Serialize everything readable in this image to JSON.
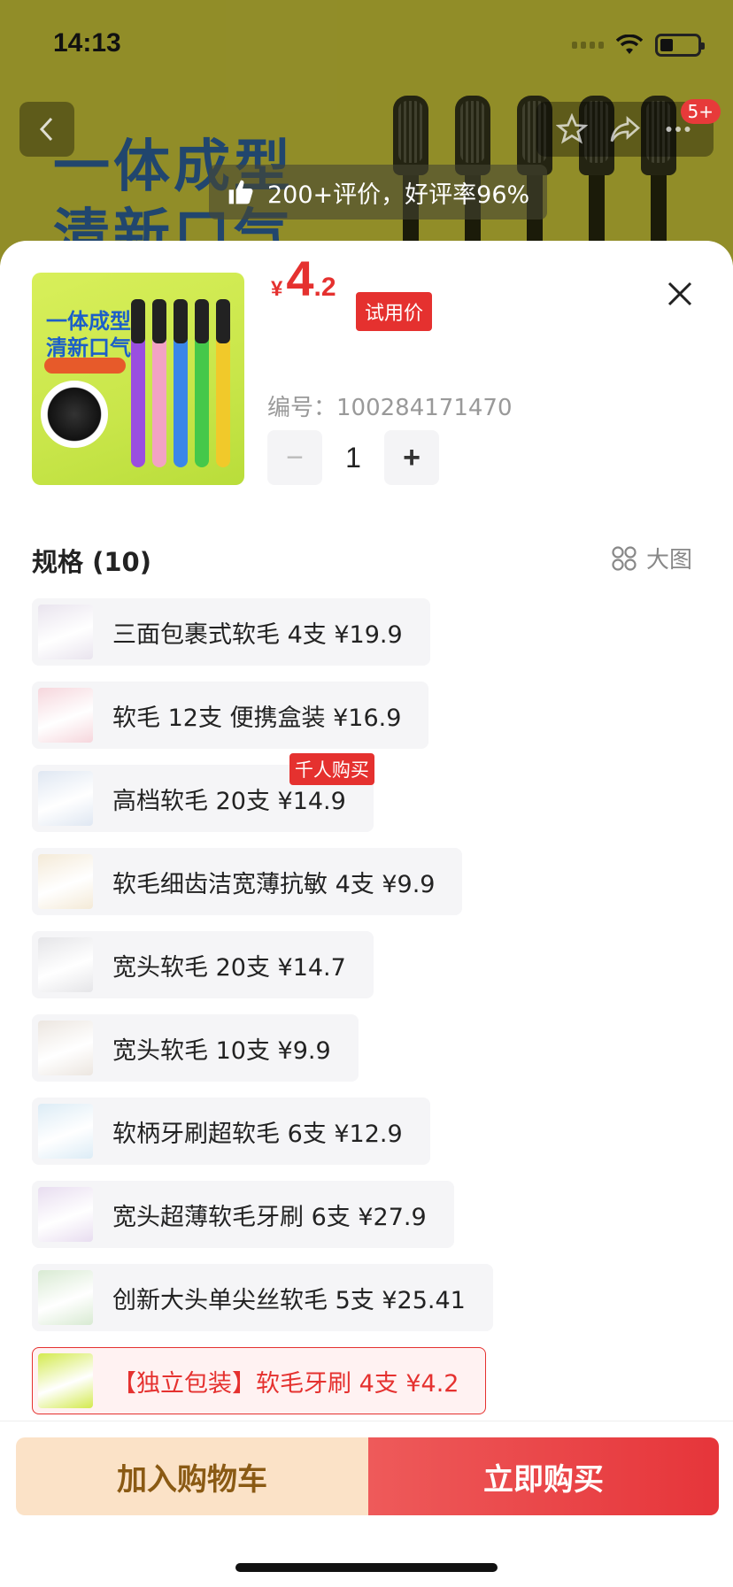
{
  "status": {
    "time": "14:13"
  },
  "background": {
    "banner_text": [
      "一体成型",
      "清新口气"
    ],
    "cart_badge": "5+",
    "rating_text": "200+评价，好评率96%"
  },
  "sheet": {
    "thumb_title": [
      "一体成型",
      "清新口气"
    ],
    "price": {
      "currency": "¥",
      "integer": "4",
      "decimal": ".2",
      "tag": "试用价"
    },
    "sku": "编号：100284171470",
    "quantity": "1",
    "spec_header": "规格 (10)",
    "big_image_label": "大图",
    "specs": [
      {
        "label": "三面包裹式软毛 4支  ¥19.9",
        "thumb_color": "#e9e4ee"
      },
      {
        "label": "软毛 12支 便携盒装  ¥16.9",
        "thumb_color": "#f6d6dc"
      },
      {
        "label": "高档软毛 20支  ¥14.9",
        "thumb_color": "#dfe7f2",
        "badge": "千人购买"
      },
      {
        "label": "软毛细齿洁宽薄抗敏 4支  ¥9.9",
        "thumb_color": "#f4ead7"
      },
      {
        "label": "宽头软毛 20支  ¥14.7",
        "thumb_color": "#e5e5e8"
      },
      {
        "label": "宽头软毛 10支  ¥9.9",
        "thumb_color": "#ece6e0"
      },
      {
        "label": "软柄牙刷超软毛 6支  ¥12.9",
        "thumb_color": "#dcecf6"
      },
      {
        "label": "宽头超薄软毛牙刷 6支  ¥27.9",
        "thumb_color": "#e8ddf0"
      },
      {
        "label": "创新大头单尖丝软毛 5支  ¥25.41",
        "thumb_color": "#d8ead2"
      },
      {
        "label": "【独立包装】软毛牙刷 4支  ¥4.2",
        "thumb_color": "#d3ea4e",
        "selected": true
      }
    ],
    "buttons": {
      "add_to_cart": "加入购物车",
      "buy_now": "立即购买"
    }
  },
  "colors": {
    "accent": "#e5312f",
    "cart_bg": "#fbe2c7"
  }
}
